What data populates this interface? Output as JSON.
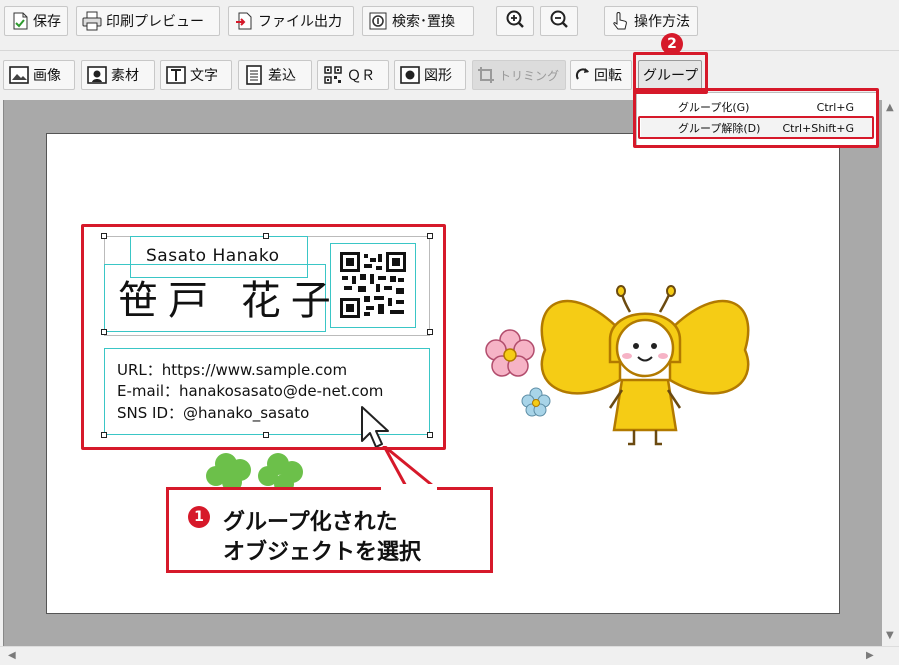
{
  "toolbar_top": {
    "save_label": "保存",
    "print_preview_label": "印刷プレビュー",
    "file_output_label": "ファイル出力",
    "search_replace_label": "検索･置換",
    "help_label": "操作方法"
  },
  "toolbar_main": {
    "image_label": "画像",
    "material_label": "素材",
    "text_label": "文字",
    "merge_label": "差込",
    "qr_label": "ＱＲ",
    "shape_label": "図形",
    "trim_label": "トリミング",
    "rotate_label": "回転",
    "group_label": "グループ"
  },
  "group_menu": {
    "items": [
      {
        "label": "グループ化(G)",
        "shortcut": "Ctrl+G"
      },
      {
        "label": "グループ解除(D)",
        "shortcut": "Ctrl+Shift+G"
      }
    ]
  },
  "card": {
    "name_en": "Sasato Hanako",
    "name_jp": "笹戸 花子",
    "url": "URL：https://www.sample.com",
    "email": "E-mail：hanakosasato@de-net.com",
    "sns": "SNS ID：@hanako_sasato"
  },
  "callout": {
    "step": "1",
    "line1": "グループ化された",
    "line2": "オブジェクトを選択"
  },
  "step2_badge": "2",
  "colors": {
    "highlight_red": "#d6192a",
    "selection_cyan": "#3ac6c6",
    "butterfly_yellow": "#f5cc15",
    "clover_green": "#6cc04a"
  }
}
